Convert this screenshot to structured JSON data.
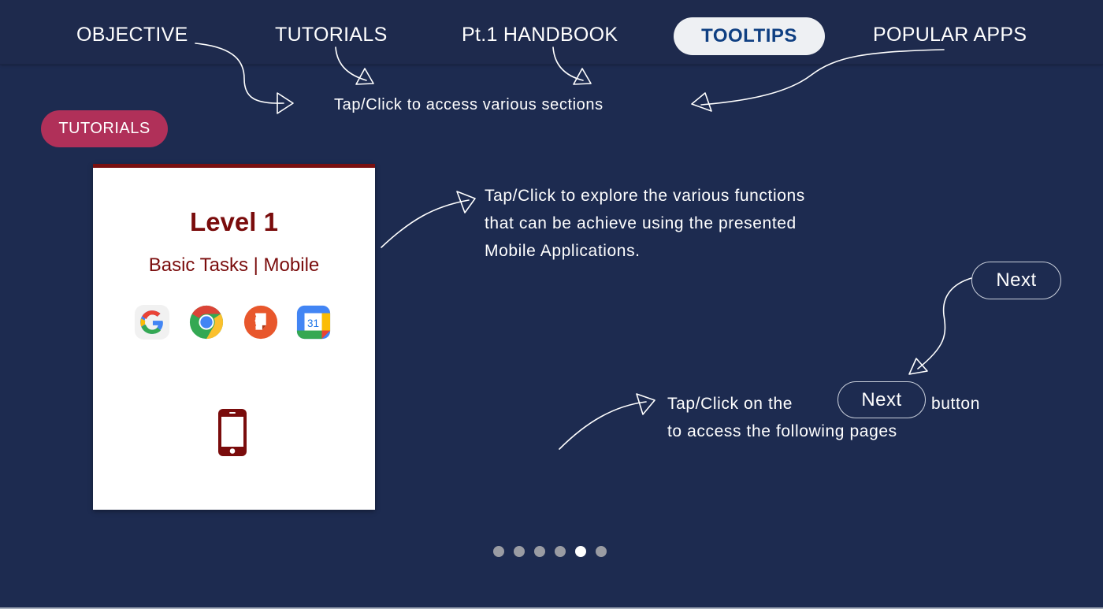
{
  "nav": {
    "items": [
      {
        "label": "OBJECTIVE"
      },
      {
        "label": "TUTORIALS"
      },
      {
        "label": "Pt.1 HANDBOOK"
      },
      {
        "label": "TOOLTIPS",
        "active": true
      },
      {
        "label": "POPULAR APPS"
      }
    ]
  },
  "annotations": {
    "nav_hint": "Tap/Click to access various sections",
    "card_hint_lines": [
      "Tap/Click to explore the various functions",
      "that can be achieve using the presented",
      "Mobile Applications."
    ],
    "next_hint_prefix": "Tap/Click on the",
    "next_hint_suffix": "button",
    "next_hint_line2": "to access the following pages"
  },
  "section_pill": "TUTORIALS",
  "card": {
    "title": "Level 1",
    "subtitle": "Basic Tasks | Mobile",
    "apps": [
      "google-icon",
      "chrome-icon",
      "notes-icon",
      "calendar-icon"
    ],
    "calendar_day": "31",
    "device_icon": "smartphone-icon"
  },
  "next_button": {
    "label": "Next"
  },
  "next_inline_button": {
    "label": "Next"
  },
  "pagination": {
    "total": 6,
    "current": 5
  },
  "colors": {
    "background": "#1d2b50",
    "active_tab_text": "#0f3f82",
    "section_pill": "#b03059",
    "card_accent": "#7a0c0c"
  }
}
